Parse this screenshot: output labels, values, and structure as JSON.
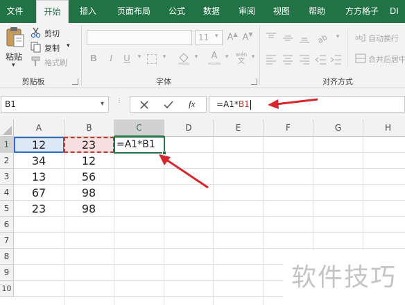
{
  "tabs": [
    "文件",
    "开始",
    "插入",
    "页面布局",
    "公式",
    "数据",
    "审阅",
    "视图",
    "帮助",
    "方方格子",
    "DI"
  ],
  "ribbon": {
    "paste_label": "粘贴",
    "cut_label": "剪切",
    "copy_label": "复制",
    "format_painter_label": "格式刷",
    "clipboard_label": "剪贴板",
    "font_size": "11",
    "bold": "B",
    "italic": "I",
    "underline": "U",
    "phonetic": "wén",
    "font_label": "字体",
    "wrap_text_label": "自动换行",
    "merge_label": "合并后居中",
    "alignment_label": "对齐方式"
  },
  "formula_bar": {
    "name_box": "B1",
    "fx_label": "fx",
    "formula_prefix": "=A1*",
    "formula_ref": "B1"
  },
  "grid": {
    "columns": [
      "A",
      "B",
      "C",
      "D",
      "E",
      "F",
      "G",
      "H"
    ],
    "rows": [
      "1",
      "2",
      "3",
      "4",
      "5",
      "6",
      "7",
      "8",
      "9",
      "10"
    ],
    "col_a": [
      "12",
      "34",
      "13",
      "67",
      "23"
    ],
    "col_b": [
      "23",
      "12",
      "56",
      "98",
      "98"
    ],
    "c1_edit": "=A1*B1"
  },
  "watermark": "软件技巧",
  "colors": {
    "excel_green": "#217346",
    "annotation_red": "#d7272e",
    "ref_blue": "#2e6ec6",
    "ref_red": "#c0392b"
  }
}
